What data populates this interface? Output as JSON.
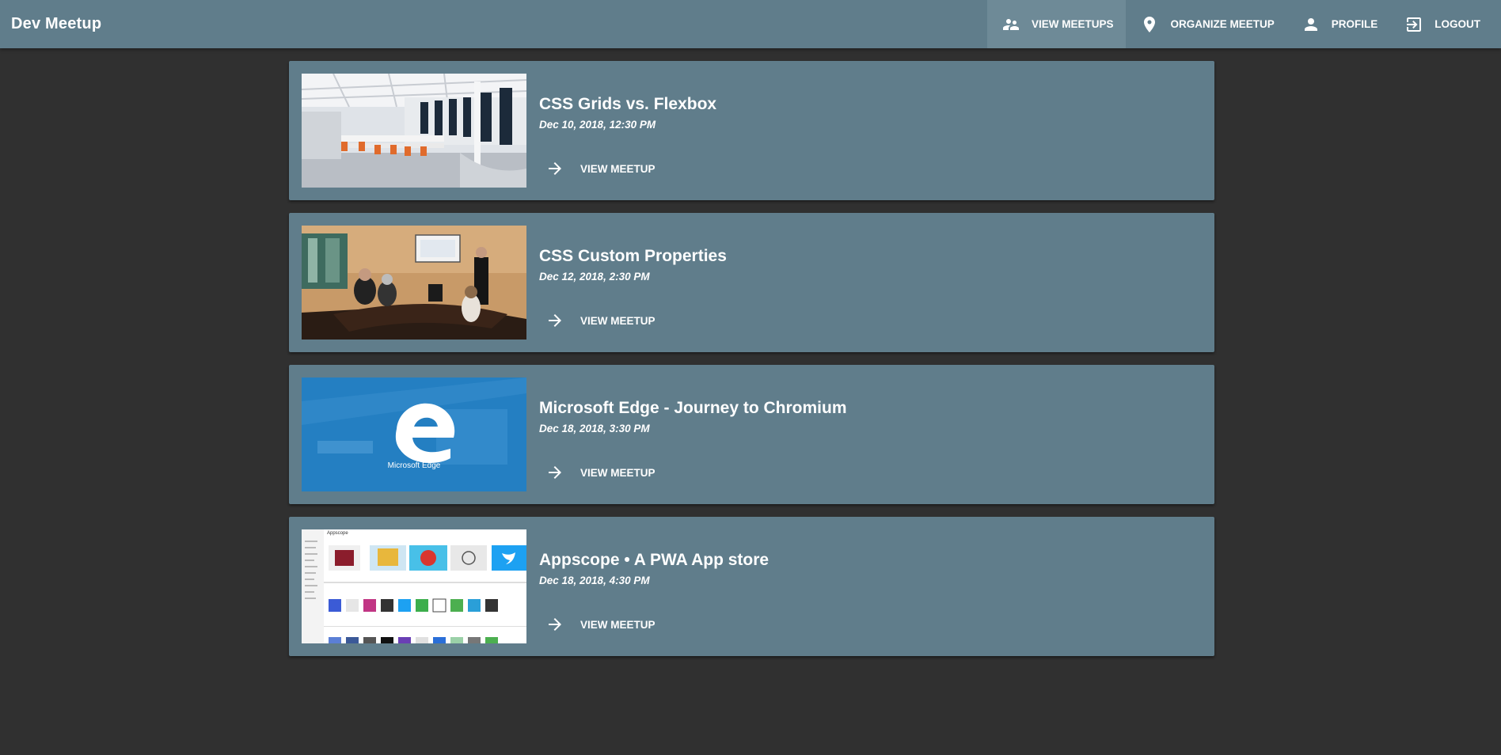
{
  "app": {
    "title": "Dev Meetup"
  },
  "nav": {
    "items": [
      {
        "label": "View Meetups",
        "icon": "supervisor-account-icon"
      },
      {
        "label": "Organize Meetup",
        "icon": "location-pin-icon"
      },
      {
        "label": "Profile",
        "icon": "person-icon"
      },
      {
        "label": "Logout",
        "icon": "exit-to-app-icon"
      }
    ]
  },
  "meetups": [
    {
      "title": "CSS Grids vs. Flexbox",
      "date": "Dec 10, 2018, 12:30 PM",
      "action": "View Meetup",
      "image": "office-room"
    },
    {
      "title": "CSS Custom Properties",
      "date": "Dec 12, 2018, 2:30 PM",
      "action": "View Meetup",
      "image": "meeting-room"
    },
    {
      "title": "Microsoft Edge - Journey to Chromium",
      "date": "Dec 18, 2018, 3:30 PM",
      "action": "View Meetup",
      "image": "edge-logo",
      "image_caption": "Microsoft Edge"
    },
    {
      "title": "Appscope • A PWA App store",
      "date": "Dec 18, 2018, 4:30 PM",
      "action": "View Meetup",
      "image": "appscope-screenshot",
      "image_label": "Appscope"
    }
  ],
  "colors": {
    "background": "#303030",
    "toolbar": "#607d8b",
    "active_nav": "#6e8a97",
    "card": "#607d8b",
    "text": "#ffffff"
  }
}
